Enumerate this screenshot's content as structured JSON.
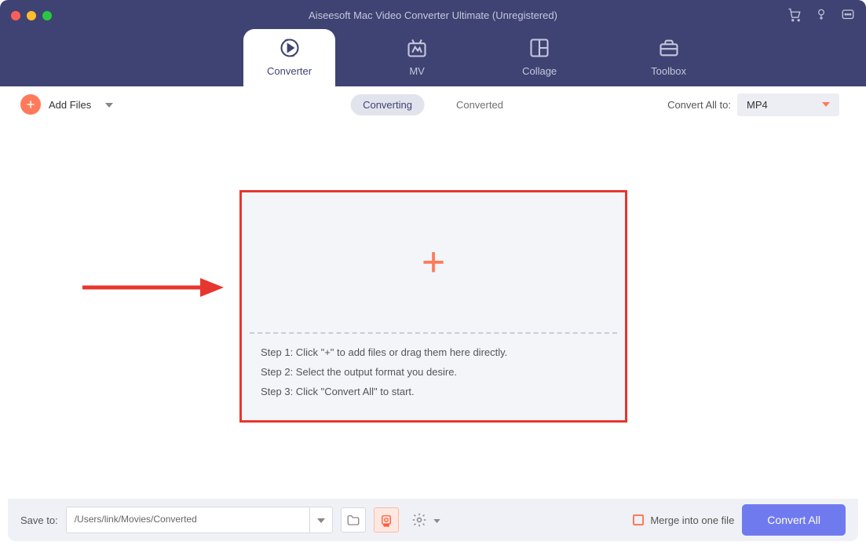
{
  "app": {
    "title": "Aiseesoft Mac Video Converter Ultimate (Unregistered)"
  },
  "colors": {
    "header_bg": "#3f4373",
    "accent": "#ff7a59",
    "primary_btn": "#707aef",
    "highlight_border": "#e7362d"
  },
  "tabs": [
    {
      "id": "converter",
      "label": "Converter",
      "active": true
    },
    {
      "id": "mv",
      "label": "MV"
    },
    {
      "id": "collage",
      "label": "Collage"
    },
    {
      "id": "toolbox",
      "label": "Toolbox"
    }
  ],
  "toolbar": {
    "add_files_label": "Add Files",
    "status_tabs": {
      "converting": "Converting",
      "converted": "Converted",
      "active": "converting"
    },
    "convert_all_label": "Convert All to:",
    "selected_format": "MP4"
  },
  "drop_zone": {
    "steps": [
      "Step 1: Click \"+\" to add files or drag them here directly.",
      "Step 2: Select the output format you desire.",
      "Step 3: Click \"Convert All\" to start."
    ]
  },
  "footer": {
    "save_to_label": "Save to:",
    "save_path": "/Users/link/Movies/Converted",
    "merge_label": "Merge into one file",
    "convert_all_btn": "Convert All"
  }
}
